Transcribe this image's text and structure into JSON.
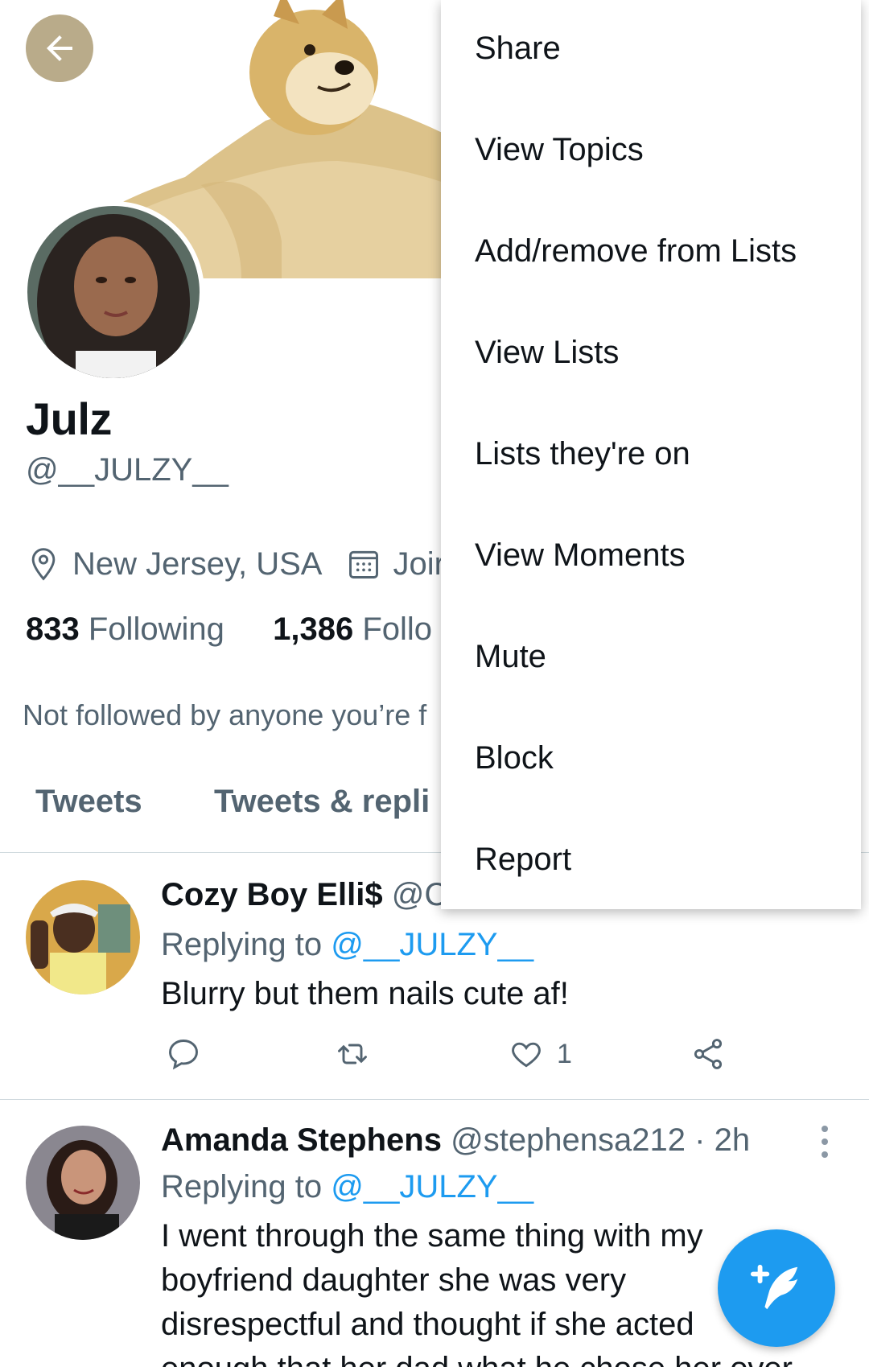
{
  "profile": {
    "display_name": "Julz",
    "handle": "@__JULZY__",
    "location": "New Jersey, USA",
    "joined_partial": "Joir",
    "following_count": "833",
    "following_label": "Following",
    "followers_count": "1,386",
    "followers_label_partial": "Follo",
    "not_followed_text": "Not followed by anyone you’re f"
  },
  "tabs": [
    {
      "label": "Tweets"
    },
    {
      "label": "Tweets & repli"
    }
  ],
  "menu": {
    "items": [
      {
        "label": "Share"
      },
      {
        "label": "View Topics"
      },
      {
        "label": "Add/remove from Lists"
      },
      {
        "label": "View Lists"
      },
      {
        "label": "Lists they're on"
      },
      {
        "label": "View Moments"
      },
      {
        "label": "Mute"
      },
      {
        "label": "Block"
      },
      {
        "label": "Report"
      }
    ]
  },
  "tweets": [
    {
      "name": "Cozy Boy Elli$",
      "handle_partial": "@C",
      "replying_prefix": "Replying to",
      "replying_mention": "@__JULZY__",
      "text": "Blurry but  them nails cute af!",
      "like_count": "1"
    },
    {
      "name": "Amanda Stephens",
      "handle": "@stephensa212",
      "time": "· 2h",
      "replying_prefix": "Replying to",
      "replying_mention": "@__JULZY__",
      "text_lines": [
        "I went through the same thing with my",
        "boyfriend daughter she was very",
        "disrespectful and thought if she acted",
        "enough that her dad what he chose her over"
      ]
    }
  ],
  "icons": {
    "back": "arrow-left-icon",
    "location": "map-pin-icon",
    "calendar": "calendar-icon",
    "reply": "reply-icon",
    "retweet": "retweet-icon",
    "like": "heart-icon",
    "share": "share-icon",
    "more": "more-vertical-icon",
    "compose": "compose-tweet-icon"
  },
  "colors": {
    "accent": "#1d9bf0",
    "secondary_text": "#536471",
    "back_button": "#b9ab8a"
  }
}
